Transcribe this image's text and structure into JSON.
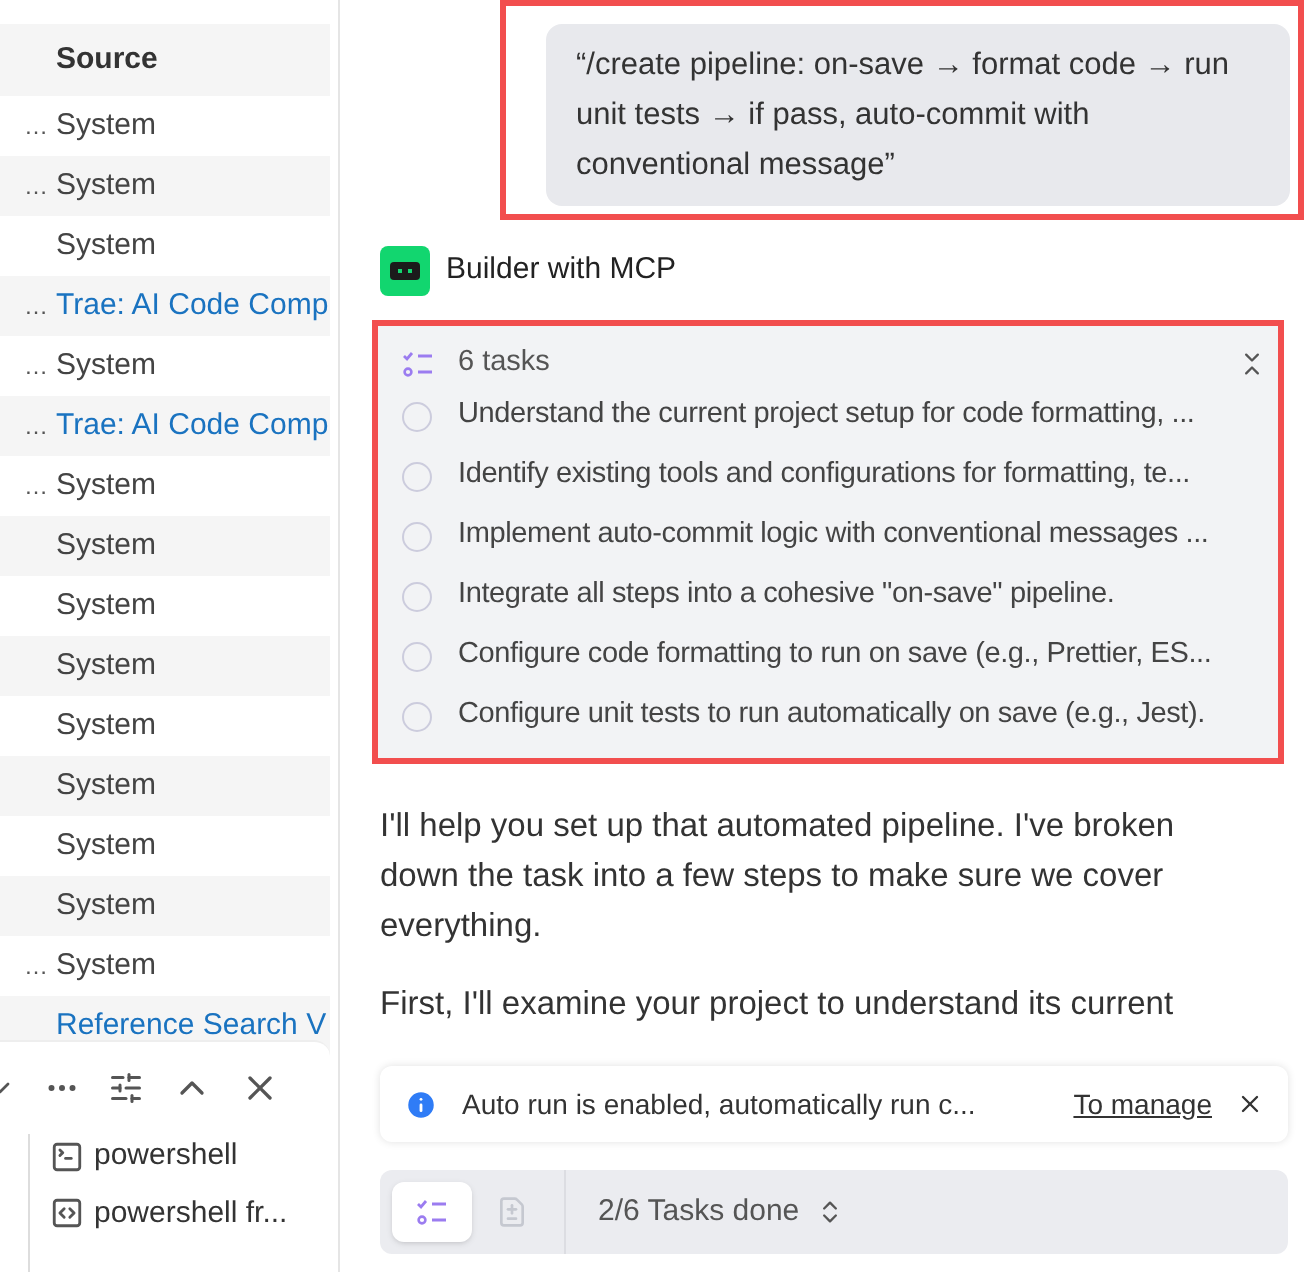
{
  "table": {
    "columns": [
      "Source"
    ],
    "rows": [
      {
        "column_1": "…",
        "source": "System",
        "kind": "plain"
      },
      {
        "column_1": "…",
        "source": "System",
        "kind": "plain"
      },
      {
        "source": "System",
        "kind": "plain"
      },
      {
        "column_1": "…",
        "source": "Trae: AI Code Comp",
        "kind": "link"
      },
      {
        "column_1": "…",
        "source": "System",
        "kind": "plain"
      },
      {
        "column_1": "…",
        "source": "Trae: AI Code Comp",
        "kind": "link"
      },
      {
        "column_1": "…",
        "source": "System",
        "kind": "plain"
      },
      {
        "source": "System",
        "kind": "plain"
      },
      {
        "source": "System",
        "kind": "plain"
      },
      {
        "source": "System",
        "kind": "plain"
      },
      {
        "source": "System",
        "kind": "plain"
      },
      {
        "source": "System",
        "kind": "plain"
      },
      {
        "source": "System",
        "kind": "plain"
      },
      {
        "source": "System",
        "kind": "plain"
      },
      {
        "column_1": "…",
        "source": "System",
        "kind": "plain"
      },
      {
        "source": "Reference Search V",
        "kind": "link"
      }
    ]
  },
  "terminal_panel": {
    "items": [
      {
        "label": "powershell",
        "kind": "terminal"
      },
      {
        "label": "powershell  fr...",
        "kind": "code"
      }
    ]
  },
  "chat": {
    "user_message": "“/create pipeline: on-save → format code → run unit tests → if pass, auto-commit with conventional message”",
    "agent_name": "Builder with MCP",
    "tasks": {
      "title": "6 tasks",
      "items": [
        {
          "label": "Understand the current project setup for code formatting, ...",
          "checked": false
        },
        {
          "label": "Identify existing tools and configurations for formatting, te...",
          "checked": false
        },
        {
          "label": "Implement auto-commit logic with conventional messages ...",
          "checked": false
        },
        {
          "label": "Integrate all steps into a cohesive \"on-save\" pipeline.",
          "checked": false
        },
        {
          "label": "Configure code formatting to run on save (e.g., Prettier, ES...",
          "checked": false
        },
        {
          "label": "Configure unit tests to run automatically on save (e.g., Jest).",
          "checked": false
        }
      ]
    },
    "paragraphs": [
      "I'll help you set up that automated pipeline. I've broken down the task into a few steps to make sure we cover everything.",
      "First, I'll examine your project to understand its current"
    ],
    "toast": {
      "message": "Auto run is enabled, automatically run c...",
      "link": "To manage"
    },
    "status_bar": {
      "tabs": [
        {
          "kind": "tasks",
          "selected": true
        },
        {
          "kind": "diff",
          "selected": false
        }
      ],
      "label": "2/6 Tasks done"
    }
  }
}
